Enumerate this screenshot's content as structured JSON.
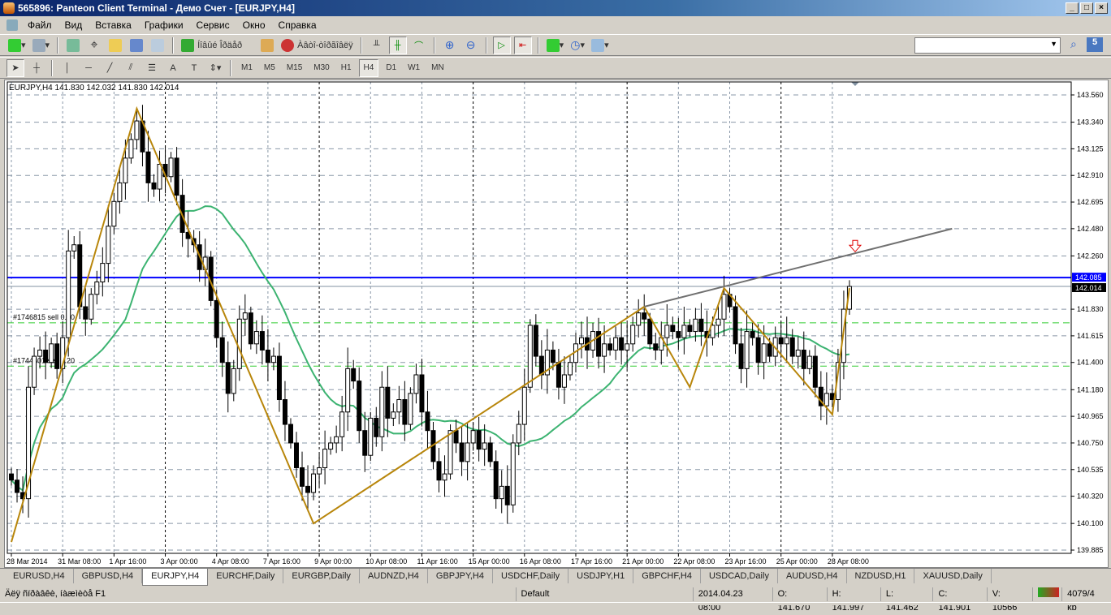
{
  "title": "565896: Panteon Client Terminal - Демо Счет - [EURJPY,H4]",
  "menu": [
    "Файл",
    "Вид",
    "Вставка",
    "Графики",
    "Сервис",
    "Окно",
    "Справка"
  ],
  "toolbar": {
    "new_order": "Íîâûé Îðäåð",
    "auto_trading": "Àâòî-òîðãîâëÿ",
    "notifications_count": "5"
  },
  "timeframes": [
    "M1",
    "M5",
    "M15",
    "M30",
    "H1",
    "H4",
    "D1",
    "W1",
    "MN"
  ],
  "active_timeframe": "H4",
  "chart_header": "EURJPY,H4  141.830 142.032 141.830 142.014",
  "tabs": [
    "EURUSD,H4",
    "GBPUSD,H4",
    "EURJPY,H4",
    "EURCHF,Daily",
    "EURGBP,Daily",
    "AUDNZD,H4",
    "GBPJPY,H4",
    "USDCHF,Daily",
    "USDJPY,H1",
    "GBPCHF,H4",
    "USDCAD,Daily",
    "AUDUSD,H4",
    "NZDUSD,H1",
    "XAUUSD,Daily"
  ],
  "active_tab": "EURJPY,H4",
  "status": {
    "help": "Äëÿ ñïðàâêè, íàæìèòå F1",
    "profile": "Default",
    "time": "2014.04.23 08:00",
    "open": "O: 141.670",
    "high": "H: 141.997",
    "low": "L: 141.462",
    "close": "C: 141.901",
    "volume": "V: 10566",
    "traffic": "4079/4 kb"
  },
  "colors": {
    "bull": "#ffffff",
    "bear": "#000000",
    "ma": "#3cb371",
    "zigzag": "#b8860b",
    "trendline": "#707070",
    "resistance": "#0000ff",
    "order": "#32cd32",
    "arrow": "#e00000"
  },
  "chart_data": {
    "type": "candlestick",
    "symbol": "EURJPY,H4",
    "ylim": [
      139.885,
      143.65
    ],
    "y_ticks": [
      "143.560",
      "143.340",
      "143.125",
      "142.910",
      "142.695",
      "142.480",
      "142.260",
      "141.830",
      "141.615",
      "141.400",
      "141.180",
      "140.965",
      "140.750",
      "140.535",
      "140.320",
      "140.100",
      "139.885"
    ],
    "x_ticks": [
      {
        "label": "28 Mar 2014",
        "index": 0
      },
      {
        "label": "31 Mar 08:00",
        "index": 9
      },
      {
        "label": "1 Apr 16:00",
        "index": 18
      },
      {
        "label": "3 Apr 00:00",
        "index": 27
      },
      {
        "label": "4 Apr 08:00",
        "index": 36
      },
      {
        "label": "7 Apr 16:00",
        "index": 45
      },
      {
        "label": "9 Apr 00:00",
        "index": 54
      },
      {
        "label": "10 Apr 08:00",
        "index": 63
      },
      {
        "label": "11 Apr 16:00",
        "index": 72
      },
      {
        "label": "15 Apr 00:00",
        "index": 81
      },
      {
        "label": "16 Apr 08:00",
        "index": 90
      },
      {
        "label": "17 Apr 16:00",
        "index": 99
      },
      {
        "label": "21 Apr 00:00",
        "index": 108
      },
      {
        "label": "22 Apr 08:00",
        "index": 117
      },
      {
        "label": "23 Apr 16:00",
        "index": 126
      },
      {
        "label": "25 Apr 00:00",
        "index": 135
      },
      {
        "label": "28 Apr 08:00",
        "index": 144
      }
    ],
    "closes": [
      140.45,
      140.35,
      140.3,
      141.2,
      141.45,
      141.5,
      141.4,
      141.55,
      141.35,
      141.6,
      142.3,
      142.35,
      141.85,
      141.75,
      141.95,
      142.05,
      142.2,
      142.5,
      142.7,
      142.85,
      143.05,
      143.2,
      143.35,
      143.1,
      142.85,
      142.8,
      143.0,
      142.9,
      143.05,
      142.75,
      142.45,
      142.4,
      142.35,
      142.15,
      142.25,
      141.9,
      141.6,
      141.4,
      141.15,
      141.35,
      141.75,
      141.8,
      141.55,
      141.65,
      141.5,
      141.4,
      141.45,
      141.1,
      140.9,
      140.75,
      140.55,
      140.4,
      140.35,
      140.5,
      140.55,
      140.7,
      140.75,
      140.8,
      141.0,
      141.35,
      141.25,
      140.85,
      140.65,
      140.95,
      140.8,
      141.2,
      140.95,
      141.0,
      141.1,
      140.9,
      141.15,
      141.3,
      141.0,
      140.85,
      140.6,
      140.45,
      140.5,
      140.85,
      140.75,
      140.6,
      140.75,
      140.85,
      140.7,
      140.75,
      140.6,
      140.3,
      140.4,
      140.25,
      140.75,
      140.9,
      141.2,
      141.7,
      141.45,
      141.3,
      141.5,
      141.4,
      141.2,
      141.3,
      141.4,
      141.55,
      141.6,
      141.5,
      141.65,
      141.45,
      141.55,
      141.5,
      141.6,
      141.5,
      141.55,
      141.7,
      141.8,
      141.75,
      141.55,
      141.5,
      141.6,
      141.7,
      141.65,
      141.6,
      141.7,
      141.65,
      141.75,
      141.65,
      141.6,
      141.7,
      141.75,
      141.95,
      141.85,
      141.55,
      141.35,
      141.65,
      141.6,
      141.4,
      141.55,
      141.45,
      141.6,
      141.55,
      141.6,
      141.45,
      141.5,
      141.35,
      141.45,
      141.2,
      141.05,
      141.15,
      141.1,
      141.4,
      141.83,
      142.014
    ],
    "ma_period": 21,
    "zigzag": [
      [
        0,
        139.95
      ],
      [
        22,
        143.45
      ],
      [
        53,
        140.1
      ],
      [
        111,
        141.85
      ],
      [
        119,
        141.2
      ],
      [
        125,
        142.0
      ],
      [
        144,
        140.98
      ],
      [
        147,
        142.0
      ]
    ],
    "trendline": [
      [
        111,
        141.85
      ],
      [
        165,
        142.48
      ]
    ],
    "resistance_level": 142.085,
    "bid_level": 142.014,
    "orders": [
      {
        "label": "#1746815 sell 0.20",
        "price": 141.72
      },
      {
        "label": "#1744801 sell 0.20",
        "price": 141.37
      }
    ],
    "arrow_down": {
      "index": 148,
      "price": 142.32
    },
    "price_labels": {
      "resistance": "142.085",
      "bid": "142.014"
    }
  }
}
